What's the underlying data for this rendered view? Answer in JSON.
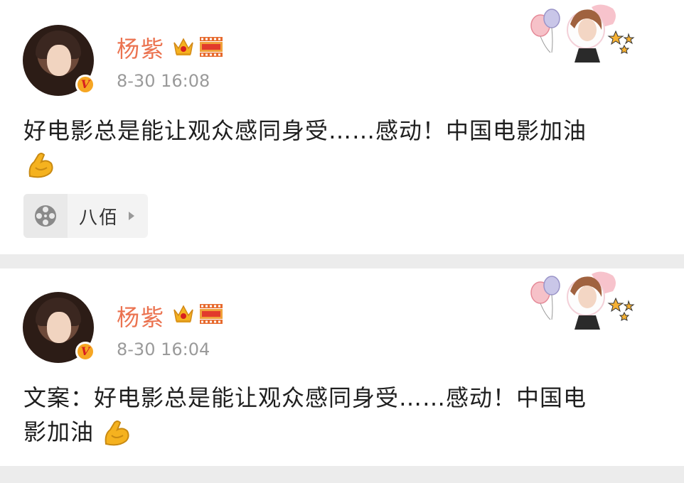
{
  "posts": [
    {
      "username": "杨紫",
      "timestamp": "8-30 16:08",
      "text": "好电影总是能让观众感同身受……感动！中国电影加油",
      "text_line2": "",
      "topic_chip": {
        "label": "八佰",
        "icon": "film-reel-icon"
      },
      "badges": [
        "crown-icon",
        "movie-icon"
      ],
      "verified": "V"
    },
    {
      "username": "杨紫",
      "timestamp": "8-30 16:04",
      "text": "文案：好电影总是能让观众感同身受……感动！中国电",
      "text_line2": "影加油",
      "badges": [
        "crown-icon",
        "movie-icon"
      ],
      "verified": "V"
    }
  ],
  "colors": {
    "username": "#eb7350",
    "timestamp": "#9a9a9a",
    "page_background": "#ececec",
    "card_background": "#ffffff",
    "verified_badge": "#f6a623"
  }
}
